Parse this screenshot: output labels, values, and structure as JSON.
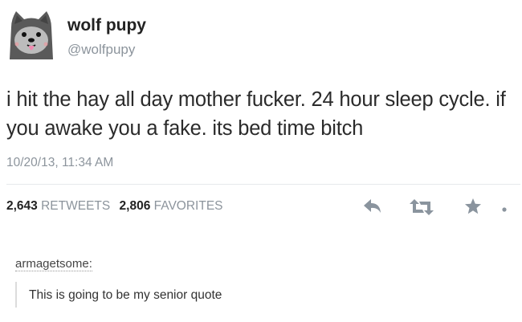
{
  "tweet": {
    "display_name": "wolf pupy",
    "handle": "@wolfpupy",
    "text": "i hit the hay all day mother fucker. 24 hour sleep cycle. if you awake you a fake. its bed time bitch",
    "timestamp": "10/20/13, 11:34 AM",
    "stats": {
      "retweets_count": "2,643",
      "retweets_label": "RETWEETS",
      "favorites_count": "2,806",
      "favorites_label": "FAVORITES"
    },
    "actions": [
      "reply-icon",
      "retweet-icon",
      "favorite-icon",
      "more-icon"
    ]
  },
  "reblog": {
    "username": "armagetsome:",
    "comment": "This is going to be my senior quote"
  },
  "colors": {
    "text": "#2b2b2b",
    "muted": "#8c949c",
    "icon": "#8a949e",
    "avatar_fur": "#5a5a5a",
    "tongue": "#f08ab0"
  }
}
